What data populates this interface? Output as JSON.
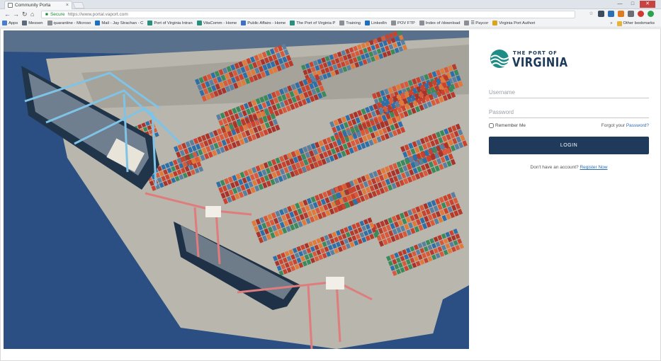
{
  "browser": {
    "tab_title": "Community Porta",
    "tab_close": "×",
    "address": {
      "secure_label": "Secure",
      "url": "https://www.portal.vaport.com"
    },
    "bookmarks": [
      {
        "label": "Apps",
        "color": "#4a7bd0"
      },
      {
        "label": "Messen",
        "color": "#5b6b7b"
      },
      {
        "label": "quarantine - Microso",
        "color": "#8a8f96"
      },
      {
        "label": "Mail - Jay Strachan - C",
        "color": "#1f6fbf"
      },
      {
        "label": "Port of Virginia Intran",
        "color": "#2a8f7a"
      },
      {
        "label": "VitaComm - Home",
        "color": "#2a8f7a"
      },
      {
        "label": "Public Affairs - Home",
        "color": "#3d6fc9"
      },
      {
        "label": "The Port of Virginia P",
        "color": "#2a8f7a"
      },
      {
        "label": "Training",
        "color": "#8a8f96"
      },
      {
        "label": "LinkedIn",
        "color": "#1f6fbf"
      },
      {
        "label": "POV FTP",
        "color": "#8a8f96"
      },
      {
        "label": "Index of /download",
        "color": "#8a8f96"
      },
      {
        "label": "☰ Paycor",
        "color": "#8a8f96"
      },
      {
        "label": "Virginia Port Authori",
        "color": "#d9a51f"
      }
    ],
    "bookmarks_more": "»",
    "other_bookmarks": "Other bookmarks"
  },
  "brand": {
    "logo_line1": "THE PORT OF",
    "logo_line2": "VIRGINIA",
    "accent": "#203a5c",
    "teal": "#1f8c86"
  },
  "login": {
    "username_placeholder": "Username",
    "password_placeholder": "Password",
    "remember_label": "Remember Me",
    "forgot_prefix": "Forgot your",
    "forgot_link": "Password?",
    "button_label": "LOGIN",
    "register_prompt": "Don't have an account?",
    "register_link": "Register Now"
  }
}
